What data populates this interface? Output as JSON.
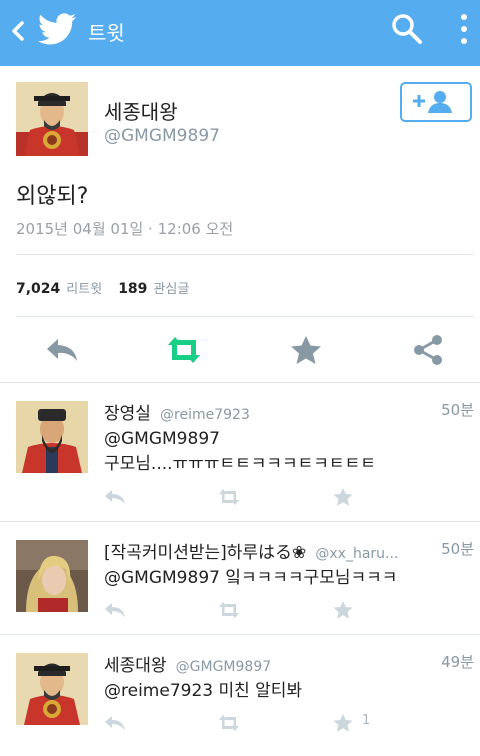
{
  "header": {
    "title": "트윗"
  },
  "main_tweet": {
    "name": "세종대왕",
    "handle": "@GMGM9897",
    "text": "외않되?",
    "date": "2015년 04월 01일 · 12:06 오전",
    "retweet_count": "7,024",
    "retweet_label": "리트윗",
    "favorite_count": "189",
    "favorite_label": "관심글"
  },
  "replies": [
    {
      "name": "장영실",
      "handle": "@reime7923",
      "time": "50분",
      "text_line1": "@GMGM9897",
      "text_line2": "구모님....ㅠㅠㅠㅌㅌㅋㅋㅋㅌㅋㅌㅌㅌ",
      "favorite_count": ""
    },
    {
      "name": "[작곡커미션받는]하루はる❀",
      "handle": "@xx_haru...",
      "time": "50분",
      "text_line1": "@GMGM9897 잌ㅋㅋㅋㅋ구모님ㅋㅋㅋ",
      "text_line2": "",
      "favorite_count": ""
    },
    {
      "name": "세종대왕",
      "handle": "@GMGM9897",
      "time": "49분",
      "text_line1": "@reime7923 미친 알티봐",
      "text_line2": "",
      "favorite_count": "1"
    }
  ],
  "colors": {
    "brand": "#55acee",
    "retweet_green": "#19cf86",
    "muted": "#8899a6",
    "icon_grey": "#ccd6dd"
  },
  "icons": [
    "back-arrow-icon",
    "twitter-bird-icon",
    "search-icon",
    "more-vertical-icon",
    "follow-user-icon",
    "reply-icon",
    "retweet-icon",
    "star-icon",
    "share-icon"
  ]
}
